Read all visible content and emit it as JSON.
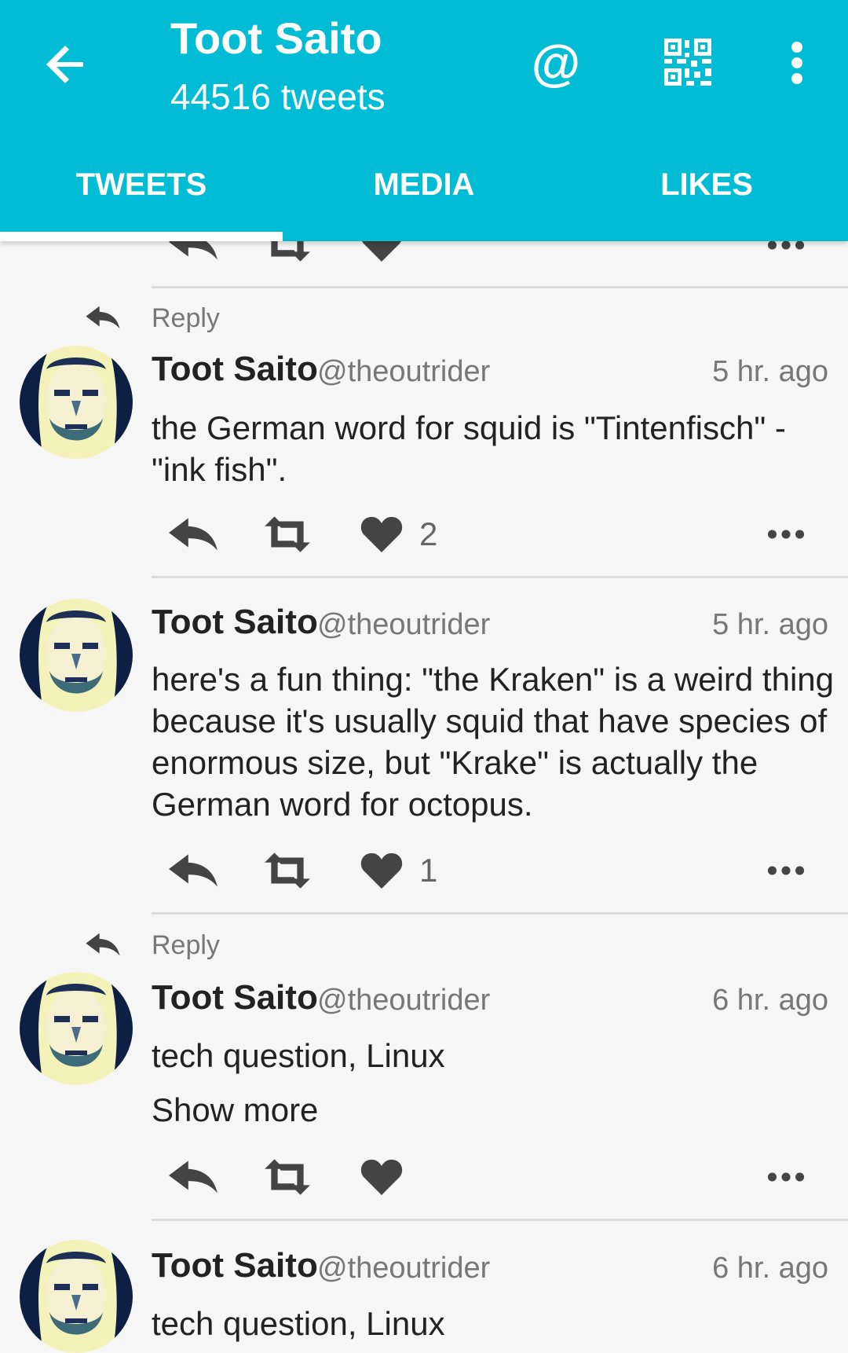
{
  "header": {
    "title": "Toot Saito",
    "subtitle": "44516 tweets",
    "mention_glyph": "@",
    "icons": [
      "back-arrow-icon",
      "at-icon",
      "qr-code-icon",
      "more-vert-icon"
    ],
    "accent_color": "#00bcd4"
  },
  "tabs": [
    {
      "label": "TWEETS",
      "active": true
    },
    {
      "label": "MEDIA",
      "active": false
    },
    {
      "label": "LIKES",
      "active": false
    }
  ],
  "reply_label": "Reply",
  "tweets": [
    {
      "name": "Toot Saito",
      "handle": "@theoutrider",
      "time": "5 hr. ago",
      "text": "the German word for squid is \"Tintenfisch\" - \"ink fish\".",
      "likes": "2",
      "is_reply": true
    },
    {
      "name": "Toot Saito",
      "handle": "@theoutrider",
      "time": "5 hr. ago",
      "text": "here's a fun thing: \"the Kraken\" is a weird thing because it's usually squid that have species of enormous size, but \"Krake\" is actually the German word for octopus.",
      "likes": "1",
      "is_reply": false
    },
    {
      "name": "Toot Saito",
      "handle": "@theoutrider",
      "time": "6 hr. ago",
      "text": "tech question, Linux",
      "show_more": "Show more",
      "likes": "",
      "is_reply": true
    },
    {
      "name": "Toot Saito",
      "handle": "@theoutrider",
      "time": "6 hr. ago",
      "text": "tech question, Linux",
      "is_reply": false
    }
  ]
}
